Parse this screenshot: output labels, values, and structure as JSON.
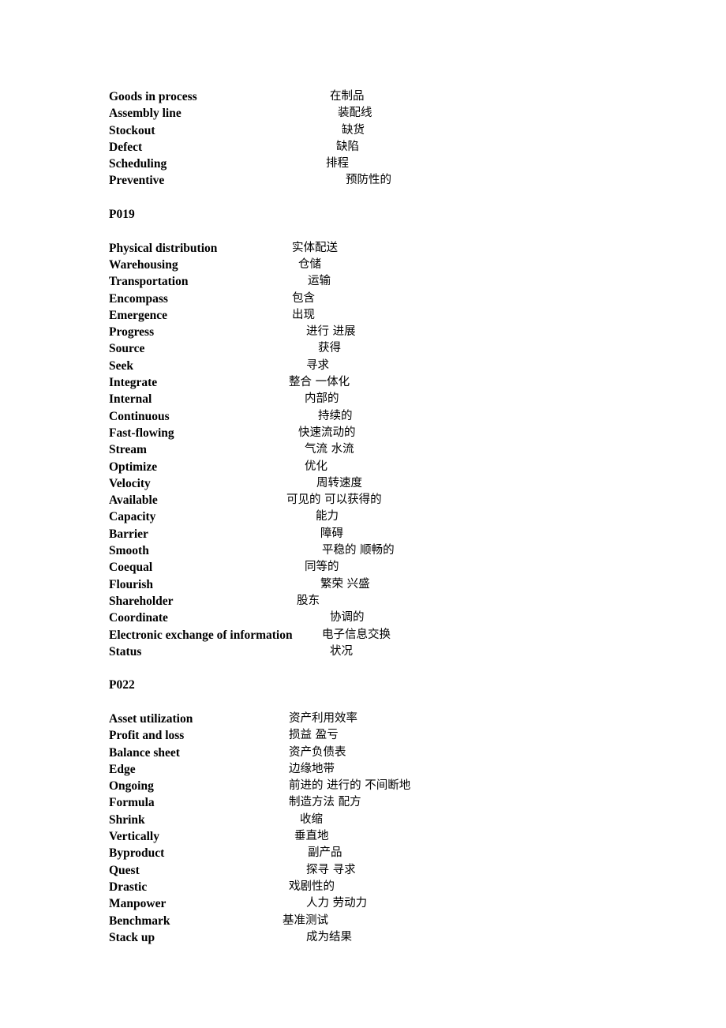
{
  "document": {
    "blocks": [
      {
        "type": "list",
        "entries": [
          {
            "term": "Goods in process",
            "gloss": "在制品",
            "indent": 280
          },
          {
            "term": "Assembly line",
            "gloss": "装配线",
            "indent": 290
          },
          {
            "term": "Stockout",
            "gloss": "缺货",
            "indent": 295
          },
          {
            "term": "Defect",
            "gloss": "缺陷",
            "indent": 288
          },
          {
            "term": "Scheduling",
            "gloss": "排程",
            "indent": 275
          },
          {
            "term": "Preventive",
            "gloss": "预防性的",
            "indent": 300
          }
        ]
      },
      {
        "type": "gap"
      },
      {
        "type": "heading",
        "text": "P019"
      },
      {
        "type": "gap"
      },
      {
        "type": "list",
        "entries": [
          {
            "term": "Physical distribution",
            "gloss": "实体配送",
            "indent": 232
          },
          {
            "term": "Warehousing",
            "gloss": "仓储",
            "indent": 240
          },
          {
            "term": "Transportation",
            "gloss": "运输",
            "indent": 252
          },
          {
            "term": "Encompass",
            "gloss": "包含",
            "indent": 232
          },
          {
            "term": "Emergence",
            "gloss": "出现",
            "indent": 232
          },
          {
            "term": "Progress",
            "gloss": "进行  进展",
            "indent": 250
          },
          {
            "term": "Source",
            "gloss": "获得",
            "indent": 265
          },
          {
            "term": "Seek",
            "gloss": "寻求",
            "indent": 250
          },
          {
            "term": "Integrate",
            "gloss": "整合  一体化",
            "indent": 228
          },
          {
            "term": "Internal",
            "gloss": "内部的",
            "indent": 248
          },
          {
            "term": "Continuous",
            "gloss": "持续的",
            "indent": 265
          },
          {
            "term": "Fast-flowing",
            "gloss": "快速流动的",
            "indent": 240
          },
          {
            "term": "Stream",
            "gloss": "气流  水流",
            "indent": 248
          },
          {
            "term": "Optimize",
            "gloss": "优化",
            "indent": 248
          },
          {
            "term": "Velocity",
            "gloss": "周转速度",
            "indent": 263
          },
          {
            "term": "Available",
            "gloss": "可见的  可以获得的",
            "indent": 225
          },
          {
            "term": "Capacity",
            "gloss": "能力",
            "indent": 262
          },
          {
            "term": "Barrier",
            "gloss": "障碍",
            "indent": 268
          },
          {
            "term": "Smooth",
            "gloss": "平稳的  顺畅的",
            "indent": 270
          },
          {
            "term": "Coequal",
            "gloss": "同等的",
            "indent": 248
          },
          {
            "term": "Flourish",
            "gloss": "繁荣  兴盛",
            "indent": 268
          },
          {
            "term": "Shareholder",
            "gloss": "股东",
            "indent": 238
          },
          {
            "term": "Coordinate",
            "gloss": "协调的",
            "indent": 280
          },
          {
            "term": "Electronic exchange of information",
            "gloss": "电子信息交换",
            "indent": 270
          },
          {
            "term": "Status",
            "gloss": "状况",
            "indent": 280
          }
        ]
      },
      {
        "type": "gap"
      },
      {
        "type": "heading",
        "text": "P022"
      },
      {
        "type": "gap"
      },
      {
        "type": "list",
        "entries": [
          {
            "term": "Asset utilization",
            "gloss": "资产利用效率",
            "indent": 228
          },
          {
            "term": "Profit and loss",
            "gloss": "损益  盈亏",
            "indent": 228
          },
          {
            "term": "Balance sheet",
            "gloss": "资产负债表",
            "indent": 228
          },
          {
            "term": "Edge",
            "gloss": "边缘地带",
            "indent": 228
          },
          {
            "term": "Ongoing",
            "gloss": "前进的  进行的  不间断地",
            "indent": 228
          },
          {
            "term": "Formula",
            "gloss": "制造方法  配方",
            "indent": 228
          },
          {
            "term": "Shrink",
            "gloss": "收缩",
            "indent": 242
          },
          {
            "term": "Vertically",
            "gloss": "垂直地",
            "indent": 235
          },
          {
            "term": "Byproduct",
            "gloss": "副产品",
            "indent": 252
          },
          {
            "term": "Quest",
            "gloss": "探寻  寻求",
            "indent": 250
          },
          {
            "term": "Drastic",
            "gloss": "戏剧性的",
            "indent": 228
          },
          {
            "term": "Manpower",
            "gloss": "人力  劳动力",
            "indent": 250
          },
          {
            "term": "Benchmark",
            "gloss": "基准测试",
            "indent": 220
          },
          {
            "term": "Stack up",
            "gloss": "成为结果",
            "indent": 250
          }
        ]
      }
    ]
  }
}
